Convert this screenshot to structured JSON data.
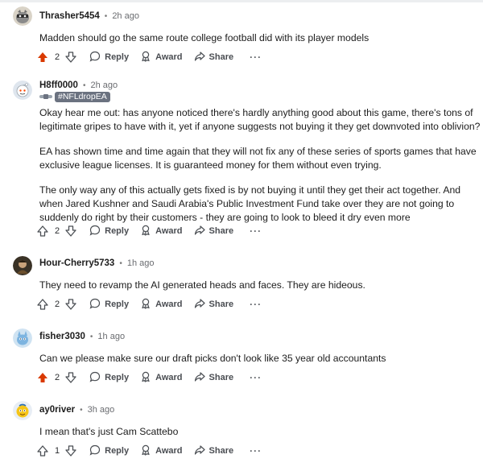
{
  "comments": [
    {
      "username": "Thrasher5454",
      "time": "2h ago",
      "flair": null,
      "paragraphs": [
        "Madden should go the same route college football did with its player models"
      ],
      "votes": "2",
      "upvoted": true
    },
    {
      "username": "H8ff0000",
      "time": "2h ago",
      "flair": "#NFLdropEA",
      "paragraphs": [
        "Okay hear me out: has anyone noticed there's hardly anything good about this game, there's tons of legitimate gripes to have with it, yet if anyone suggests not buying it they get downvoted into oblivion?",
        "EA has shown time and time again that they will not fix any of these series of sports games that have exclusive league licenses. It is guaranteed money for them without even trying.",
        "The only way any of this actually gets fixed is by not buying it until they get their act together. And when Jared Kushner and Saudi Arabia's Public Investment Fund take over they are not going to suddenly do right by their customers - they are going to look to bleed it dry even more"
      ],
      "votes": "2",
      "upvoted": false
    },
    {
      "username": "Hour-Cherry5733",
      "time": "1h ago",
      "flair": null,
      "paragraphs": [
        "They need to revamp the AI generated heads and faces. They are hideous."
      ],
      "votes": "2",
      "upvoted": false
    },
    {
      "username": "fisher3030",
      "time": "1h ago",
      "flair": null,
      "paragraphs": [
        "Can we please make sure our draft picks don't look like 35 year old accountants"
      ],
      "votes": "2",
      "upvoted": true
    },
    {
      "username": "ay0river",
      "time": "3h ago",
      "flair": null,
      "paragraphs": [
        "I mean that's just Cam Scattebo"
      ],
      "votes": "1",
      "upvoted": false
    }
  ],
  "actions": {
    "reply": "Reply",
    "award": "Award",
    "share": "Share",
    "more": "···"
  },
  "colors": {
    "upvote_active": "#d93900",
    "icon_default": "#4b4f54"
  }
}
